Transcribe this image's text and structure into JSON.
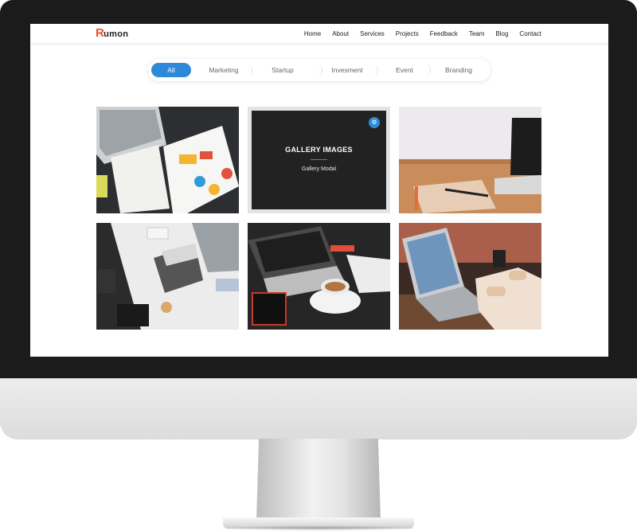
{
  "brand": {
    "logo_mark": "R",
    "logo_text": "umon"
  },
  "nav": {
    "items": [
      "Home",
      "About",
      "Services",
      "Projects",
      "Feedback",
      "Team",
      "Blog",
      "Contact"
    ]
  },
  "filters": {
    "items": [
      "All",
      "Marketing",
      "Startup",
      "Invesment",
      "Event",
      "Branding"
    ],
    "active": "All"
  },
  "gallery": {
    "overlay_title": "GALLERY IMAGES",
    "overlay_subtitle": "Gallery Modal",
    "overlay_button_icon": "settings-sliders-icon"
  },
  "colors": {
    "accent": "#2e8ad8",
    "logo": "#e8542a"
  }
}
